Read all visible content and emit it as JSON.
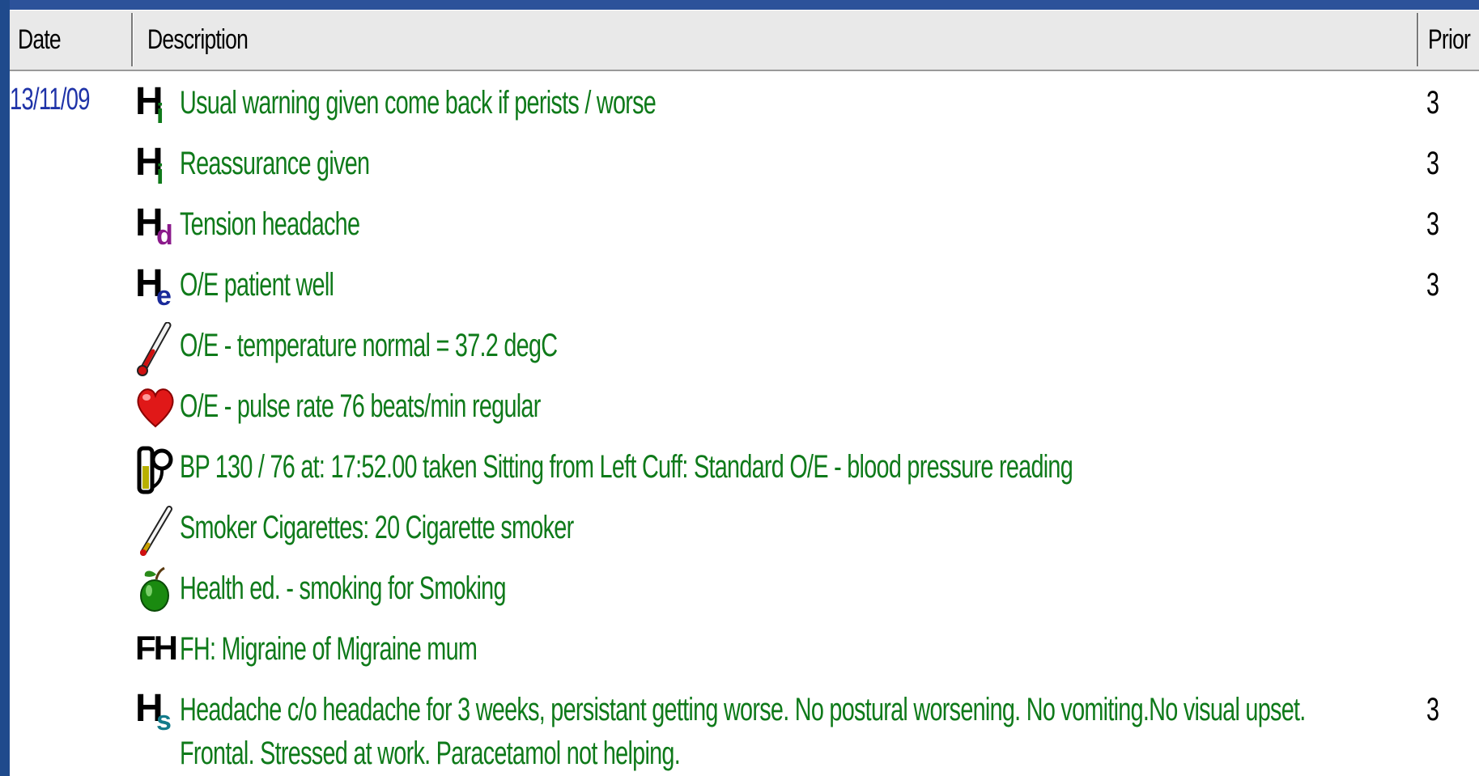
{
  "columns": {
    "date": "Date",
    "description": "Description",
    "priority": "Prior"
  },
  "rows": [
    {
      "date": "13/11/09",
      "icon": "history-information-icon",
      "icon_letter": "H",
      "icon_sub": "i",
      "icon_sub_color": "#0f7a1a",
      "description": "Usual warning given come back if perists / worse",
      "priority": "3"
    },
    {
      "date": "",
      "icon": "history-information-icon",
      "icon_letter": "H",
      "icon_sub": "i",
      "icon_sub_color": "#0f7a1a",
      "description": "Reassurance given",
      "priority": "3"
    },
    {
      "date": "",
      "icon": "history-diagnosis-icon",
      "icon_letter": "H",
      "icon_sub": "d",
      "icon_sub_color": "#8b1a8b",
      "description": "Tension headache",
      "priority": "3"
    },
    {
      "date": "",
      "icon": "history-examination-icon",
      "icon_letter": "H",
      "icon_sub": "e",
      "icon_sub_color": "#1a2a9a",
      "description": "O/E patient well",
      "priority": "3"
    },
    {
      "date": "",
      "icon": "thermometer-icon",
      "description": "O/E - temperature normal = 37.2 degC",
      "priority": ""
    },
    {
      "date": "",
      "icon": "heart-icon",
      "description": "O/E - pulse rate   76 beats/min  regular",
      "priority": ""
    },
    {
      "date": "",
      "icon": "blood-pressure-icon",
      "description": "BP 130 / 76  at: 17:52.00 taken  Sitting  from  Left  Cuff:  Standard   O/E - blood pressure reading",
      "priority": ""
    },
    {
      "date": "",
      "icon": "cigarette-icon",
      "description": "Smoker  Cigarettes: 20   Cigarette smoker",
      "priority": ""
    },
    {
      "date": "",
      "icon": "apple-icon",
      "description": "Health ed. - smoking  for Smoking",
      "priority": ""
    },
    {
      "date": "",
      "icon": "family-history-icon",
      "icon_letter": "FH",
      "description": "FH: Migraine of Migraine mum",
      "priority": ""
    },
    {
      "date": "",
      "icon": "history-symptom-icon",
      "icon_letter": "H",
      "icon_sub": "s",
      "icon_sub_color": "#127a8a",
      "description": "Headache c/o headache for 3 weeks, persistant getting worse.  No postural worsening. No vomiting.No visual upset.",
      "description_line2": "Frontal. Stressed at work. Paracetamol not helping.",
      "priority": "3"
    }
  ]
}
